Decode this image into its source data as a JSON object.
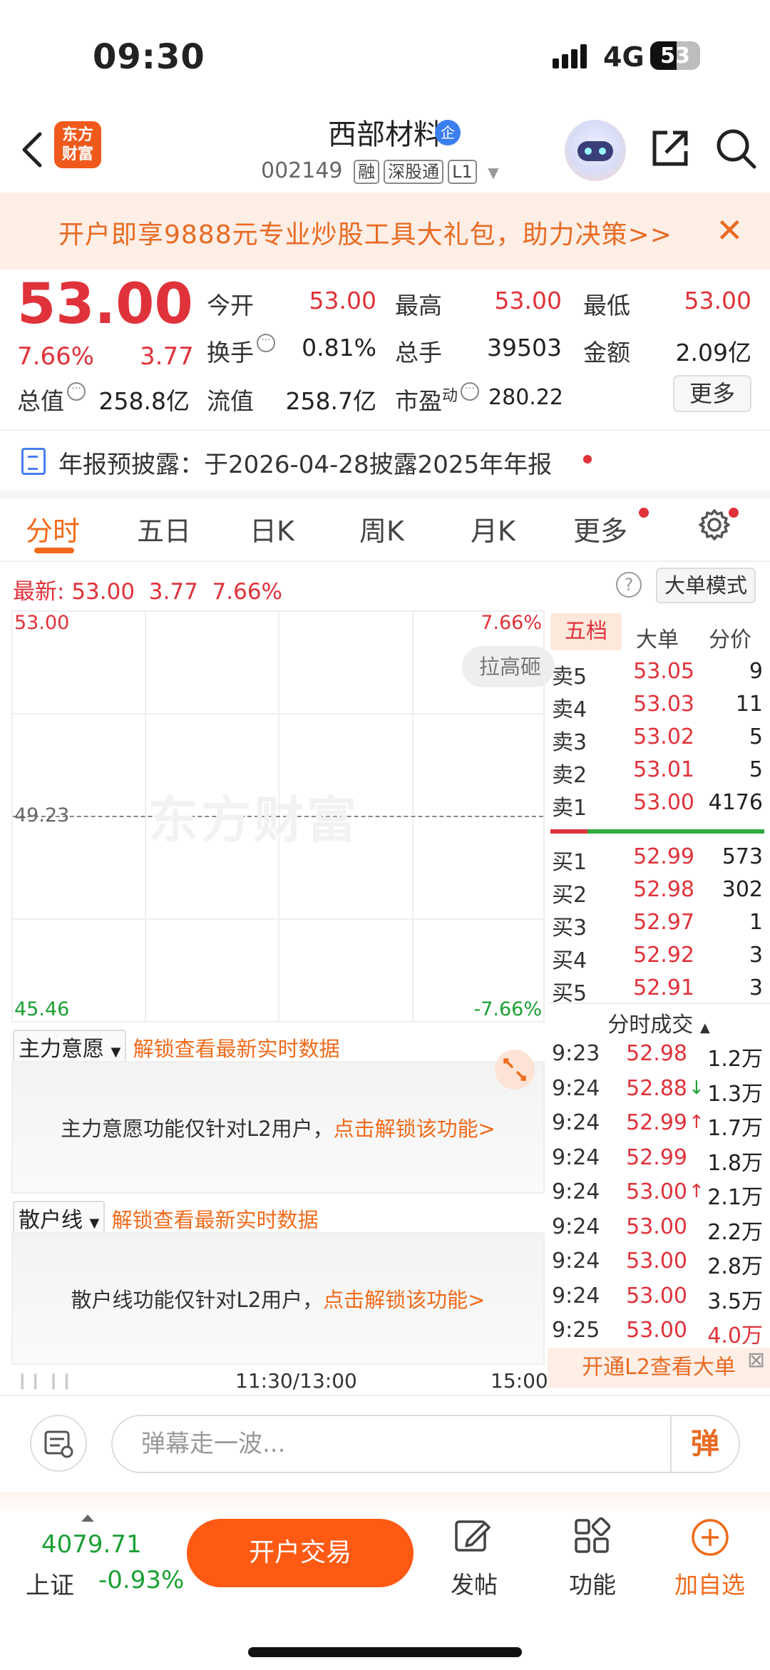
{
  "status_bar": {
    "time": "09:30",
    "network": "4G",
    "battery": "53"
  },
  "header": {
    "stock_name": "西部材料",
    "verify_badge": "企",
    "code": "002149",
    "tags": [
      "融",
      "深股通",
      "L1"
    ],
    "logo_lines": [
      "东方",
      "财富"
    ]
  },
  "banner": {
    "text": "开户即享9888元专业炒股工具大礼包，助力决策>>",
    "close": "✕"
  },
  "quote": {
    "price": "53.00",
    "change_pct": "7.66%",
    "change": "3.77",
    "open_label": "今开",
    "open": "53.00",
    "high_label": "最高",
    "high": "53.00",
    "low_label": "最低",
    "low": "53.00",
    "turnover_label": "换手",
    "turnover": "0.81%",
    "volume_label": "总手",
    "volume": "39503",
    "amount_label": "金额",
    "amount": "2.09亿",
    "mktcap_label": "总值",
    "mktcap": "258.8亿",
    "float_label": "流值",
    "float": "258.7亿",
    "pe_label": "市盈",
    "pe_sup": "动",
    "pe": "280.22",
    "more": "更多"
  },
  "notice": {
    "text": "年报预披露：于2026-04-28披露2025年年报"
  },
  "tabs": [
    "分时",
    "五日",
    "日K",
    "周K",
    "月K",
    "更多"
  ],
  "latest": {
    "label": "最新:",
    "price": "53.00",
    "change": "3.77",
    "pct": "7.66%",
    "help": "?",
    "mode_btn": "大单模式"
  },
  "chart": {
    "y_top": "53.00",
    "y_mid": "49.23",
    "y_bottom": "45.46",
    "pct_top": "7.66%",
    "pct_bottom": "-7.66%",
    "watermark": "东方财富",
    "bubble": "拉高砸",
    "x_mid": "11:30/13:00",
    "x_end": "15:00"
  },
  "panels": [
    {
      "dropdown": "主力意愿",
      "unlock": "解锁查看最新实时数据",
      "msg": "主力意愿功能仅针对L2用户，",
      "link": "点击解锁该功能>"
    },
    {
      "dropdown": "散户线",
      "unlock": "解锁查看最新实时数据",
      "msg": "散户线功能仅针对L2用户，",
      "link": "点击解锁该功能>"
    }
  ],
  "orderbook": {
    "tabs": [
      "五档",
      "大单",
      "分价"
    ],
    "asks": [
      {
        "label": "卖5",
        "price": "53.05",
        "vol": "9"
      },
      {
        "label": "卖4",
        "price": "53.03",
        "vol": "11"
      },
      {
        "label": "卖3",
        "price": "53.02",
        "vol": "5"
      },
      {
        "label": "卖2",
        "price": "53.01",
        "vol": "5"
      },
      {
        "label": "卖1",
        "price": "53.00",
        "vol": "4176"
      }
    ],
    "bids": [
      {
        "label": "买1",
        "price": "52.99",
        "vol": "573"
      },
      {
        "label": "买2",
        "price": "52.98",
        "vol": "302"
      },
      {
        "label": "买3",
        "price": "52.97",
        "vol": "1"
      },
      {
        "label": "买4",
        "price": "52.92",
        "vol": "3"
      },
      {
        "label": "买5",
        "price": "52.91",
        "vol": "3"
      }
    ]
  },
  "ticks": {
    "title": "分时成交",
    "rows": [
      {
        "t": "9:23",
        "p": "52.98",
        "a": "",
        "v": "1.2万",
        "vc": "#222"
      },
      {
        "t": "9:24",
        "p": "52.88",
        "a": "↓",
        "ac": "#1aa034",
        "v": "1.3万",
        "vc": "#222"
      },
      {
        "t": "9:24",
        "p": "52.99",
        "a": "↑",
        "ac": "#e0323a",
        "v": "1.7万",
        "vc": "#222"
      },
      {
        "t": "9:24",
        "p": "52.99",
        "a": "",
        "v": "1.8万",
        "vc": "#222"
      },
      {
        "t": "9:24",
        "p": "53.00",
        "a": "↑",
        "ac": "#e0323a",
        "v": "2.1万",
        "vc": "#222"
      },
      {
        "t": "9:24",
        "p": "53.00",
        "a": "",
        "v": "2.2万",
        "vc": "#222"
      },
      {
        "t": "9:24",
        "p": "53.00",
        "a": "",
        "v": "2.8万",
        "vc": "#222"
      },
      {
        "t": "9:24",
        "p": "53.00",
        "a": "",
        "v": "3.5万",
        "vc": "#222"
      },
      {
        "t": "9:25",
        "p": "53.00",
        "a": "",
        "v": "4.0万",
        "vc": "#e0323a"
      }
    ],
    "l2": "开通L2查看大单"
  },
  "danmu": {
    "placeholder": "弹幕走一波...",
    "btn": "弹"
  },
  "bottom": {
    "index_value": "4079.71",
    "index_name": "上证",
    "index_pct": "-0.93%",
    "trade": "开户交易",
    "post": "发帖",
    "func": "功能",
    "add": "加自选"
  },
  "colors": {
    "up": "#e0323a",
    "down": "#1aa034",
    "accent": "#f06a1a"
  }
}
